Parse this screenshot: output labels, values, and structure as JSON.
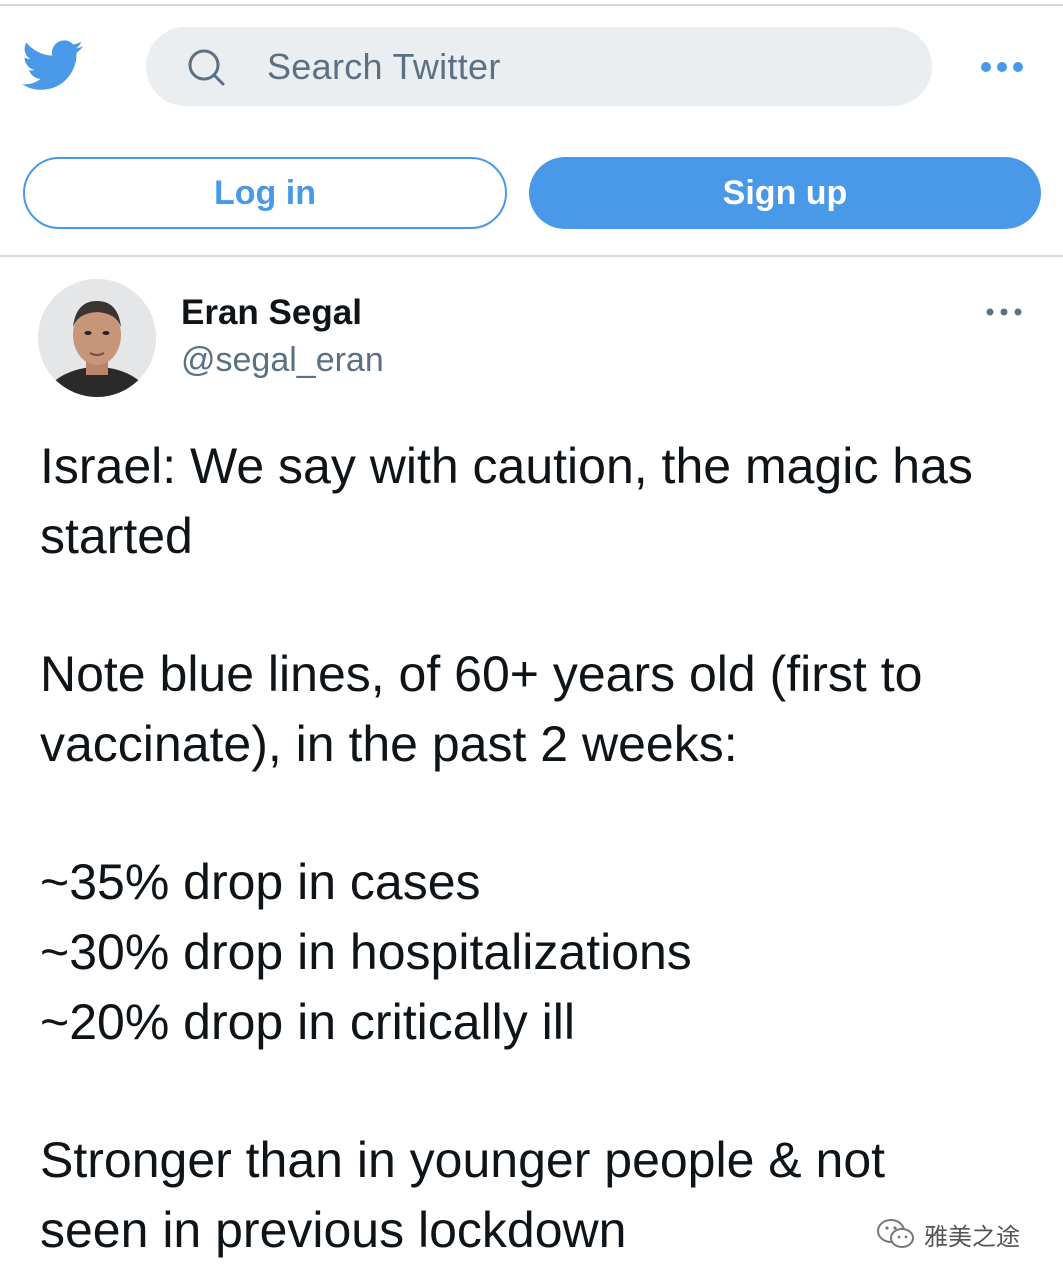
{
  "header": {
    "search_placeholder": "Search Twitter",
    "logo_icon": "twitter-bird-icon",
    "more_icon": "more-horizontal-icon"
  },
  "auth": {
    "login_label": "Log in",
    "signup_label": "Sign up"
  },
  "tweet": {
    "author_name": "Eran Segal",
    "author_handle": "@segal_eran",
    "lines": [
      "Israel: We say with caution, the magic has",
      "started",
      "Note blue lines, of 60+ years old (first to",
      "vaccinate), in the past 2 weeks:",
      "~35% drop in cases",
      "~30% drop in hospitalizations",
      "~20% drop in critically ill",
      "Stronger than in younger people & not",
      "seen in previous lockdown"
    ]
  },
  "watermark": {
    "text": "雅美之途"
  },
  "colors": {
    "brand": "#4a99e9",
    "secondary_text": "#5b7083",
    "search_bg": "#ebeef0"
  }
}
